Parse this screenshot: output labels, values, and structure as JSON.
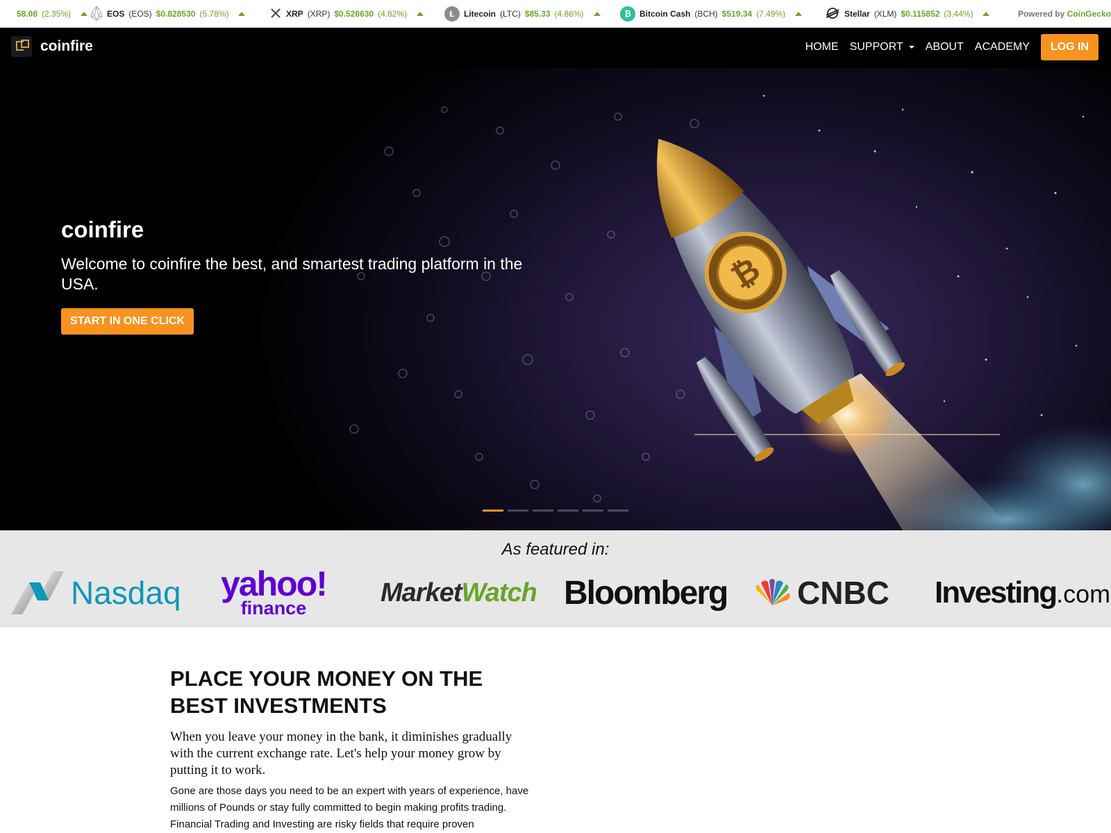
{
  "ticker": {
    "items": [
      {
        "name": "",
        "symbol": "",
        "price": "58.08",
        "change": "(2.35%)",
        "icon": "truncated-coin-icon"
      },
      {
        "name": "EOS",
        "symbol": "(EOS)",
        "price": "$0.828530",
        "change": "(5.78%)",
        "icon": "eos-icon"
      },
      {
        "name": "XRP",
        "symbol": "(XRP)",
        "price": "$0.528630",
        "change": "(4.82%)",
        "icon": "xrp-icon"
      },
      {
        "name": "Litecoin",
        "symbol": "(LTC)",
        "price": "$85.33",
        "change": "(4.86%)",
        "icon": "litecoin-icon"
      },
      {
        "name": "Bitcoin Cash",
        "symbol": "(BCH)",
        "price": "$519.34",
        "change": "(7.49%)",
        "icon": "bitcoin-cash-icon"
      },
      {
        "name": "Stellar",
        "symbol": "(XLM)",
        "price": "$0.115852",
        "change": "(3.44%)",
        "icon": "stellar-icon"
      }
    ],
    "powered_by": "Powered by",
    "provider": "CoinGecko",
    "up_color": "#6aa42b"
  },
  "nav": {
    "brand": "coinfire",
    "items": [
      "HOME",
      "SUPPORT",
      "ABOUT",
      "ACADEMY"
    ],
    "login": "LOG IN",
    "accent": "#f7931e"
  },
  "hero": {
    "title": "coinfire",
    "subtitle": "Welcome to coinfire the best, and smartest trading platform in the USA.",
    "cta": "START IN ONE CLICK",
    "slides_total": 6,
    "active_slide": 1
  },
  "featured": {
    "label": "As featured in:",
    "outlets": {
      "nasdaq": "Nasdaq",
      "yahoo_top": "yahoo!",
      "yahoo_bottom": "finance",
      "mw_a": "Market",
      "mw_b": "Watch",
      "bloomberg": "Bloomberg",
      "cnbc": "CNBC",
      "investing": "Investing",
      "investing_suffix": ".com"
    }
  },
  "content": {
    "heading": "PLACE YOUR MONEY ON THE BEST INVESTMENTS",
    "lead": "When you leave your money in the bank, it diminishes gradually with the current exchange rate. Let's help your money grow by putting it to work.",
    "body": "Gone are those days you need to be an expert with years of experience, have millions of Pounds or stay fully committed to begin making profits trading. Financial Trading and Investing are risky fields that require proven"
  }
}
